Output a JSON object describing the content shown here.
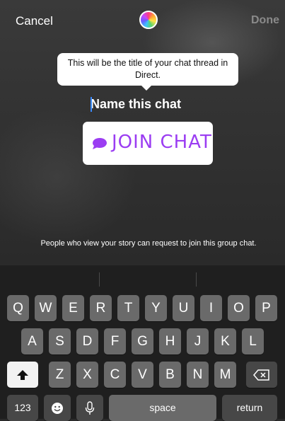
{
  "topbar": {
    "cancel_label": "Cancel",
    "done_label": "Done",
    "color_picker_icon": "color-wheel-icon"
  },
  "tooltip": {
    "text": "This will be the title of your chat thread in Direct."
  },
  "chat_name": {
    "placeholder": "Name this chat"
  },
  "sticker": {
    "icon": "chat-bubble-icon",
    "label": "JOIN CHAT",
    "accent_color": "#9b3df2"
  },
  "hint": {
    "text": "People who view your story can request to join this group chat."
  },
  "keyboard": {
    "row1": [
      "Q",
      "W",
      "E",
      "R",
      "T",
      "Y",
      "U",
      "I",
      "O",
      "P"
    ],
    "row2": [
      "A",
      "S",
      "D",
      "F",
      "G",
      "H",
      "J",
      "K",
      "L"
    ],
    "row3": [
      "Z",
      "X",
      "C",
      "V",
      "B",
      "N",
      "M"
    ],
    "numbers_label": "123",
    "space_label": "space",
    "return_label": "return",
    "shift_icon": "shift-arrow-icon",
    "backspace_icon": "backspace-icon",
    "emoji_icon": "emoji-icon",
    "mic_icon": "microphone-icon"
  }
}
